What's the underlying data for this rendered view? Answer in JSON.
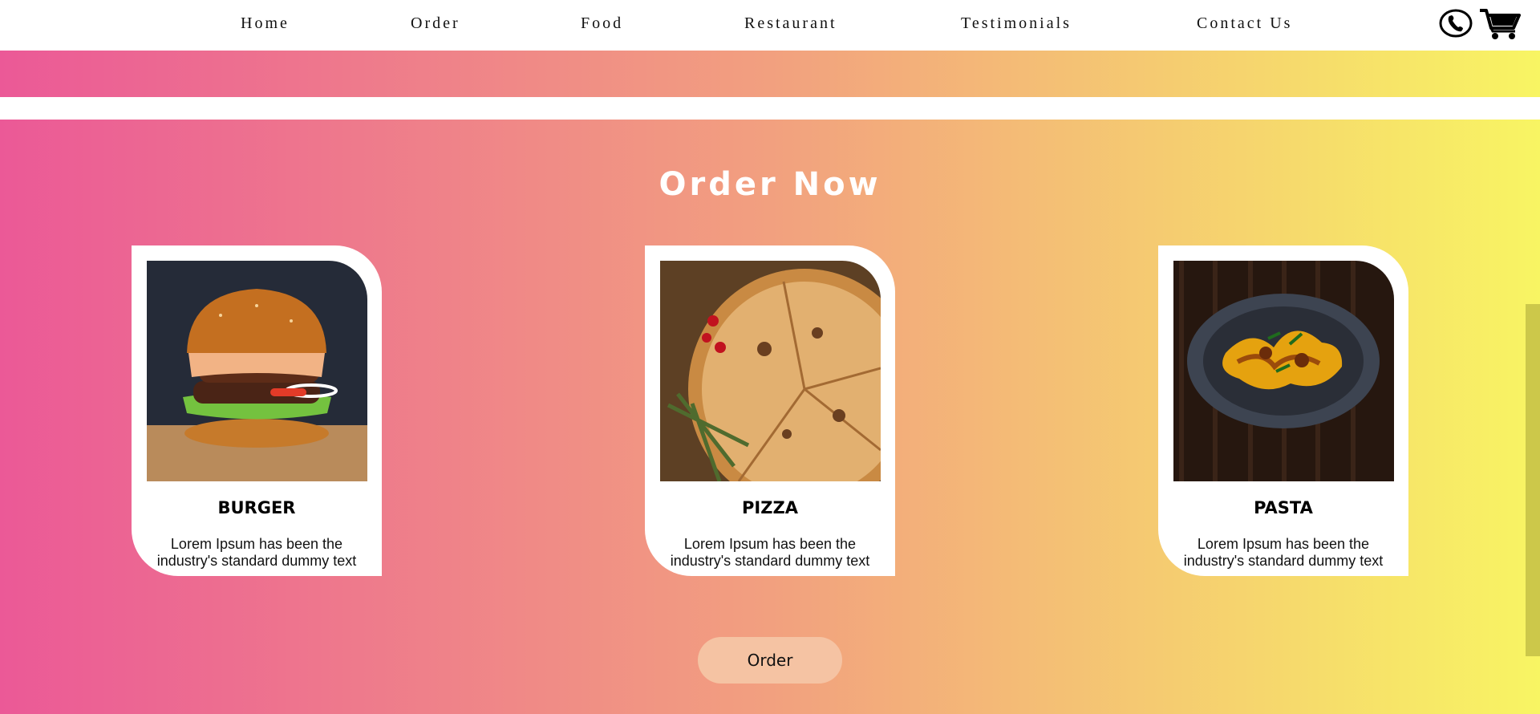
{
  "nav": {
    "items": [
      {
        "label": "Home"
      },
      {
        "label": "Order"
      },
      {
        "label": "Food"
      },
      {
        "label": "Restaurant"
      },
      {
        "label": "Testimonials"
      },
      {
        "label": "Contact Us"
      }
    ],
    "icons": [
      "phone-icon",
      "cart-icon"
    ]
  },
  "order_section": {
    "title": "Order Now",
    "cards": [
      {
        "title": "BURGER",
        "description_line_1": "Lorem Ipsum has been the",
        "description_line_2": "industry's standard dummy text",
        "image": "burger-photo"
      },
      {
        "title": "PIZZA",
        "description_line_1": "Lorem Ipsum has been the",
        "description_line_2": "industry's standard dummy text",
        "image": "pizza-photo"
      },
      {
        "title": "PASTA",
        "description_line_1": "Lorem Ipsum has been the",
        "description_line_2": "industry's standard dummy text",
        "image": "pasta-photo"
      }
    ],
    "button_label": "Order"
  },
  "colors": {
    "gradient_start": "#eb5997",
    "gradient_mid": "#f2a07f",
    "gradient_end": "#f8f563",
    "button_bg": "#f5c3a3",
    "scrollbar": "#ccc84a"
  }
}
